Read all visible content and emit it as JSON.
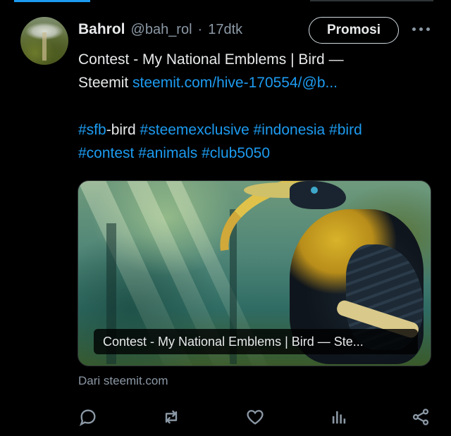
{
  "post": {
    "author_name": "Bahrol",
    "author_handle": "@bah_rol",
    "separator": "·",
    "time": "17dtk",
    "promo_label": "Promosi",
    "text_line1": "Contest - My National Emblems | Bird —",
    "text_line2_prefix": "Steemit",
    "link_text": "steemit.com/hive-170554/@b...",
    "hashtags_line1": [
      {
        "text": "#sfb",
        "link": true
      },
      {
        "text": "-bird",
        "link": false
      },
      {
        "text": " #steemexclusive",
        "link": true
      },
      {
        "text": " #indonesia",
        "link": true
      },
      {
        "text": " #bird",
        "link": true
      }
    ],
    "hashtags_line2": [
      "#contest",
      "#animals",
      "#club5050"
    ],
    "card_caption": "Contest - My National Emblems | Bird — Ste...",
    "source_text": "Dari steemit.com"
  },
  "colors": {
    "background": "#000000",
    "text": "#e7e9ea",
    "muted": "#8b98a5",
    "link": "#1d9bf0"
  },
  "icons": {
    "more": "more-options-icon",
    "reply": "reply-icon",
    "repost": "repost-icon",
    "like": "like-heart-icon",
    "views": "views-chart-icon",
    "share": "share-icon"
  }
}
